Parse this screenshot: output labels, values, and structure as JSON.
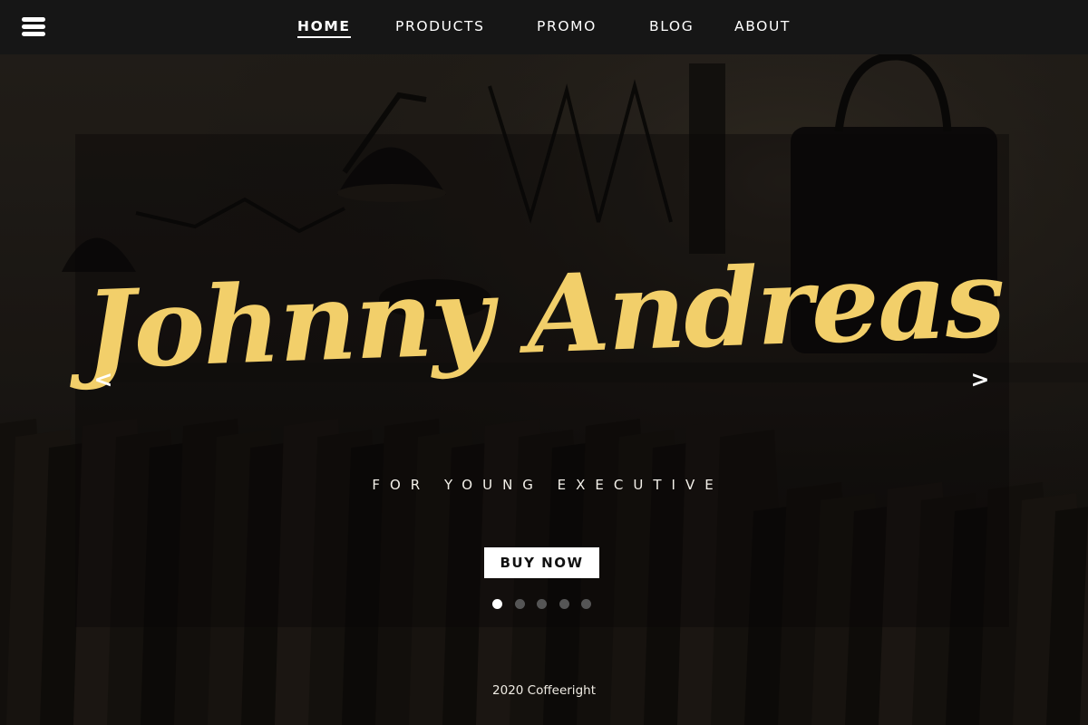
{
  "nav": {
    "menu_icon": "hamburger-menu-icon",
    "items": [
      {
        "label": "HOME",
        "active": true
      },
      {
        "label": "PRODUCTS",
        "active": false
      },
      {
        "label": "PROMO",
        "active": false
      },
      {
        "label": "BLOG",
        "active": false
      },
      {
        "label": "ABOUT",
        "active": false
      }
    ]
  },
  "hero": {
    "title": "Johnny Andreas",
    "subtitle": "FOR YOUNG EXECUTIVE",
    "cta_label": "BUY NOW",
    "prev_arrow": "<",
    "next_arrow": ">",
    "slide_count": 5,
    "active_slide": 1
  },
  "footer": {
    "copyright": "2020 Coffeeright"
  },
  "colors": {
    "title_gold": "#f2cf6a",
    "nav_background": "#161616",
    "button_background": "#ffffff",
    "dot_active": "#ffffff",
    "dot_inactive": "#555555"
  }
}
